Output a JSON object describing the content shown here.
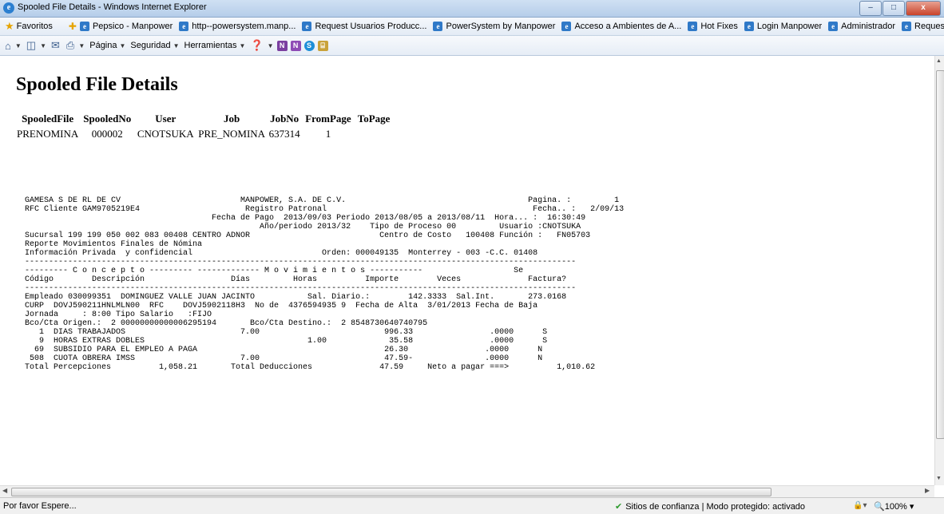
{
  "window": {
    "title": "Spooled File Details - Windows Internet Explorer",
    "min": "–",
    "max": "□",
    "close": "x"
  },
  "favorites": {
    "label": "Favoritos",
    "items": [
      "Pepsico - Manpower",
      "http--powersystem.manp...",
      "Request Usuarios Producc...",
      "PowerSystem by Manpower",
      "Acceso a Ambientes de A...",
      "Hot Fixes",
      "Login Manpower",
      "Administrador",
      "Request"
    ]
  },
  "command_bar": {
    "pagina": "Página",
    "seguridad": "Seguridad",
    "herramientas": "Herramientas"
  },
  "page": {
    "title": "Spooled File Details",
    "table": {
      "headers": [
        "SpooledFile",
        "SpooledNo",
        "User",
        "Job",
        "JobNo",
        "FromPage",
        "ToPage"
      ],
      "row": {
        "spooled_file": "PRENOMINA",
        "spooled_no": "000002",
        "user": "CNOTSUKA",
        "job": "PRE_NOMINA",
        "job_no": "637314",
        "from_page": "1",
        "to_page": ""
      }
    },
    "report": [
      "GAMESA S DE RL DE CV                         MANPOWER, S.A. DE C.V.                                      Pagina. :         1",
      "RFC Cliente GAM9705219E4                      Registro Patronal                                           Fecha.. :   2/09/13",
      "                                       Fecha de Pago  2013/09/03 Periodo 2013/08/05 a 2013/08/11  Hora... :  16:30:49",
      "                                                 Año/periodo 2013/32    Tipo de Proceso 00         Usuario :CNOTSUKA",
      "Sucursal 199 199 050 002 083 00408 CENTRO ADNOR                           Centro de Costo   100408 Función :   FN05703",
      "Reporte Movimientos Finales de Nómina",
      "Información Privada  y confidencial                           Orden: 000049135  Monterrey - 003 -C.C. 01408",
      "-------------------------------------------------------------------------------------------------------------------",
      "--------- C o n c e p t o --------- ------------- M o v i m i e n t o s -----------                   Se",
      "Código        Descripción                  Días         Horas          Importe        Veces              Factura?",
      "-------------------------------------------------------------------------------------------------------------------",
      "Empleado 030099351  DOMINGUEZ VALLE JUAN JACINTO           Sal. Diario.:        142.3333  Sal.Int.       273.0168",
      "CURP  DOVJ590211HNLMLN00  RFC    DOVJ5902118H3  No de  4376594935 9  Fecha de Alta  3/01/2013 Fecha de Baja",
      "Jornada     : 8:00 Tipo Salario   :FIJO",
      "Bco/Cta Origen.:  2 00000000000006295194       Bco/Cta Destino.:  2 8548730640740795",
      "   1  DIAS TRABAJADOS                        7.00                          996.33                .0000      S",
      "   9  HORAS EXTRAS DOBLES                                  1.00             35.58                .0000      S",
      "  69  SUBSIDIO PARA EL EMPLEO A PAGA                                       26.30                .0000      N",
      " 508  CUOTA OBRERA IMSS                      7.00                          47.59-               .0000      N",
      "Total Percepciones          1,058.21       Total Deducciones              47.59     Neto a pagar ===>          1,010.62"
    ]
  },
  "status": {
    "left": "Por favor Espere...",
    "secure": "Sitios de confianza | Modo protegido: activado",
    "zoom": "100%"
  }
}
